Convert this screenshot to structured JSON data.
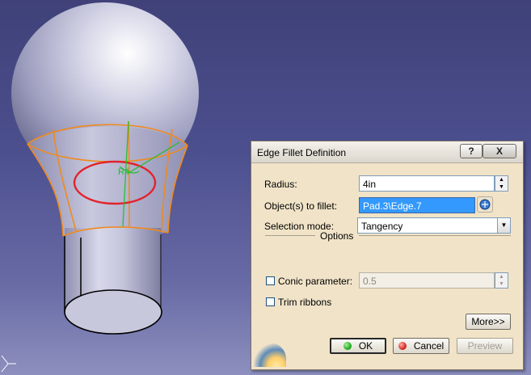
{
  "dialog": {
    "title": "Edge Fillet Definition",
    "help_label": "?",
    "close_label": "X",
    "radius_label": "Radius:",
    "radius_value": "4in",
    "objects_label": "Object(s) to fillet:",
    "objects_value": "Pad.3\\Edge.7",
    "selection_mode_label": "Selection mode:",
    "selection_mode_value": "Tangency",
    "options_label": "Options",
    "conic_label": "Conic parameter:",
    "conic_value": "0.5",
    "conic_checked": false,
    "trim_label": "Trim ribbons",
    "trim_checked": false,
    "more_label": "More>>",
    "ok_label": "OK",
    "cancel_label": "Cancel",
    "preview_label": "Preview"
  },
  "viewport": {
    "radius_annotation": "R4",
    "background_top": "#3f4178",
    "background_bottom": "#8d8fbe",
    "highlight_color": "#e3232b",
    "preview_color": "#f08a1e",
    "axis_color": "#1fbf2a"
  }
}
